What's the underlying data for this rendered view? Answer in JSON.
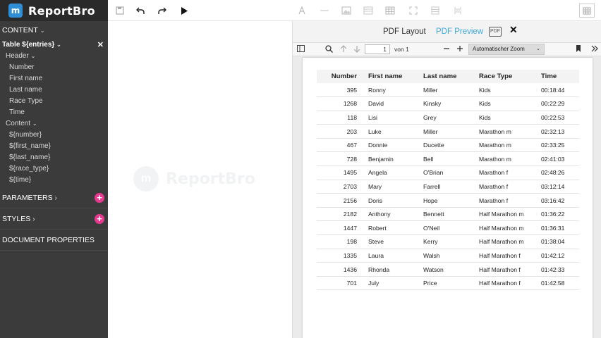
{
  "brand": {
    "name": "ReportBro",
    "logo_glyph": "m"
  },
  "sidebar": {
    "content_label": "CONTENT",
    "table_label": "Table ${entries}",
    "header_label": "Header",
    "header_items": [
      "Number",
      "First name",
      "Last name",
      "Race Type",
      "Time"
    ],
    "content_sub_label": "Content",
    "content_items": [
      "${number}",
      "${first_name}",
      "${last_name}",
      "${race_type}",
      "${time}"
    ],
    "parameters_label": "PARAMETERS",
    "styles_label": "STYLES",
    "document_properties_label": "DOCUMENT PROPERTIES",
    "chevron_down": "⌄",
    "chevron_right": "›",
    "close_glyph": "✕",
    "plus_glyph": "+"
  },
  "canvas": {
    "watermark_text": "ReportBro",
    "watermark_logo": "m"
  },
  "preview": {
    "tab_layout": "PDF Layout",
    "tab_preview": "PDF Preview",
    "pdf_icon_text": "PDF",
    "close_glyph": "✕",
    "page_current": "1",
    "page_of": "von 1",
    "zoom_label": "Automatischer Zoom",
    "zoom_dropdown": "⌄",
    "table": {
      "headers": [
        "Number",
        "First name",
        "Last name",
        "Race Type",
        "Time"
      ],
      "rows": [
        [
          "395",
          "Ronny",
          "Miller",
          "Kids",
          "00:18:44"
        ],
        [
          "1268",
          "David",
          "Kinsky",
          "Kids",
          "00:22:29"
        ],
        [
          "118",
          "Lisi",
          "Grey",
          "Kids",
          "00:22:53"
        ],
        [
          "203",
          "Luke",
          "Miller",
          "Marathon m",
          "02:32:13"
        ],
        [
          "467",
          "Donnie",
          "Ducette",
          "Marathon m",
          "02:33:25"
        ],
        [
          "728",
          "Benjamin",
          "Bell",
          "Marathon m",
          "02:41:03"
        ],
        [
          "1495",
          "Angela",
          "O'Brian",
          "Marathon f",
          "02:48:26"
        ],
        [
          "2703",
          "Mary",
          "Farrell",
          "Marathon f",
          "03:12:14"
        ],
        [
          "2156",
          "Doris",
          "Hope",
          "Marathon f",
          "03:16:42"
        ],
        [
          "2182",
          "Anthony",
          "Bennett",
          "Half Marathon m",
          "01:36:22"
        ],
        [
          "1447",
          "Robert",
          "O'Neil",
          "Half Marathon m",
          "01:36:31"
        ],
        [
          "198",
          "Steve",
          "Kerry",
          "Half Marathon m",
          "01:38:04"
        ],
        [
          "1335",
          "Laura",
          "Walsh",
          "Half Marathon f",
          "01:42:12"
        ],
        [
          "1436",
          "Rhonda",
          "Watson",
          "Half Marathon f",
          "01:42:33"
        ],
        [
          "701",
          "July",
          "Price",
          "Half Marathon f",
          "01:42:58"
        ]
      ]
    }
  },
  "colors": {
    "sidebar_bg": "#3b3b3b",
    "accent_pink": "#e53a8f",
    "accent_blue": "#3fa7d6"
  }
}
